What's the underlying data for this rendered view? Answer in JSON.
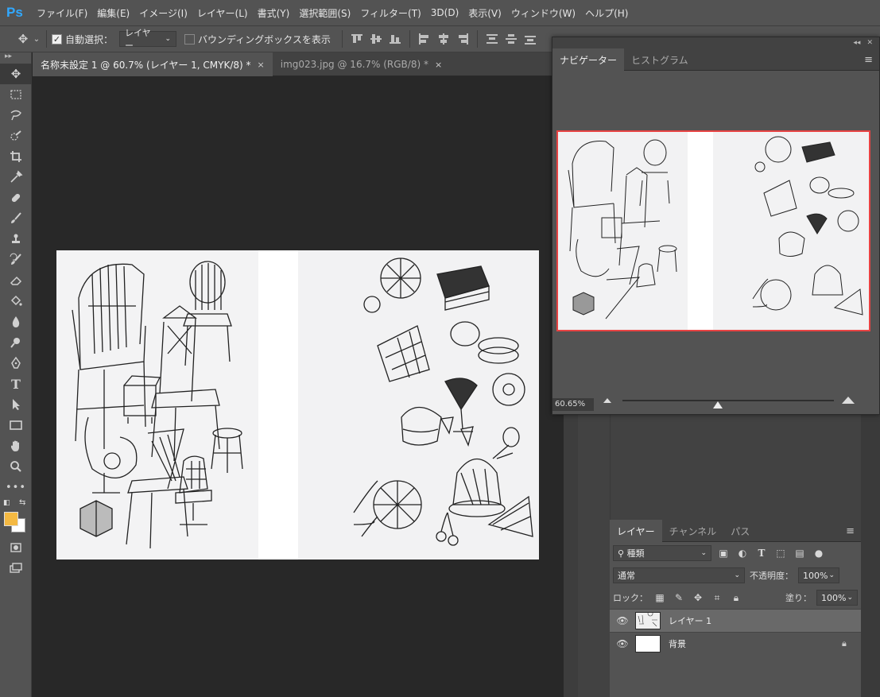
{
  "app": {
    "logo": "Ps"
  },
  "menu": [
    "ファイル(F)",
    "編集(E)",
    "イメージ(I)",
    "レイヤー(L)",
    "書式(Y)",
    "選択範囲(S)",
    "フィルター(T)",
    "3D(D)",
    "表示(V)",
    "ウィンドウ(W)",
    "ヘルプ(H)"
  ],
  "options": {
    "auto_select_label": "自動選択：",
    "auto_select_checked": true,
    "auto_select_target": "レイヤー",
    "bounding_box_label": "バウンディングボックスを表示",
    "bounding_box_checked": false
  },
  "tabs": [
    {
      "label": "名称未設定 1 @ 60.7% (レイヤー 1, CMYK/8) *",
      "active": true
    },
    {
      "label": "img023.jpg @ 16.7% (RGB/8) *",
      "active": false
    }
  ],
  "tab_close_glyph": "×",
  "tools": [
    "move-tool",
    "marquee-tool",
    "lasso-tool",
    "quick-select-tool",
    "crop-tool",
    "eyedropper-tool",
    "healing-brush-tool",
    "brush-tool",
    "clone-stamp-tool",
    "history-brush-tool",
    "eraser-tool",
    "paint-bucket-tool",
    "blur-tool",
    "dodge-tool",
    "pen-tool",
    "type-tool",
    "path-select-tool",
    "rectangle-tool",
    "hand-tool",
    "zoom-tool",
    "more-tools"
  ],
  "colors": {
    "foreground": "#f4b942",
    "background": "#ffffff",
    "nav_frame": "#e84343"
  },
  "navigator": {
    "tabs": [
      "ナビゲーター",
      "ヒストグラム"
    ],
    "zoom": "60.65%"
  },
  "layers": {
    "tabs": [
      "レイヤー",
      "チャンネル",
      "パス"
    ],
    "filter_kind": "種類",
    "blend_mode": "通常",
    "opacity_label": "不透明度：",
    "opacity": "100%",
    "lock_label": "ロック：",
    "fill_label": "塗り：",
    "fill": "100%",
    "items": [
      {
        "name": "レイヤー 1",
        "selected": true,
        "locked": false
      },
      {
        "name": "背景",
        "selected": false,
        "locked": true
      }
    ]
  }
}
